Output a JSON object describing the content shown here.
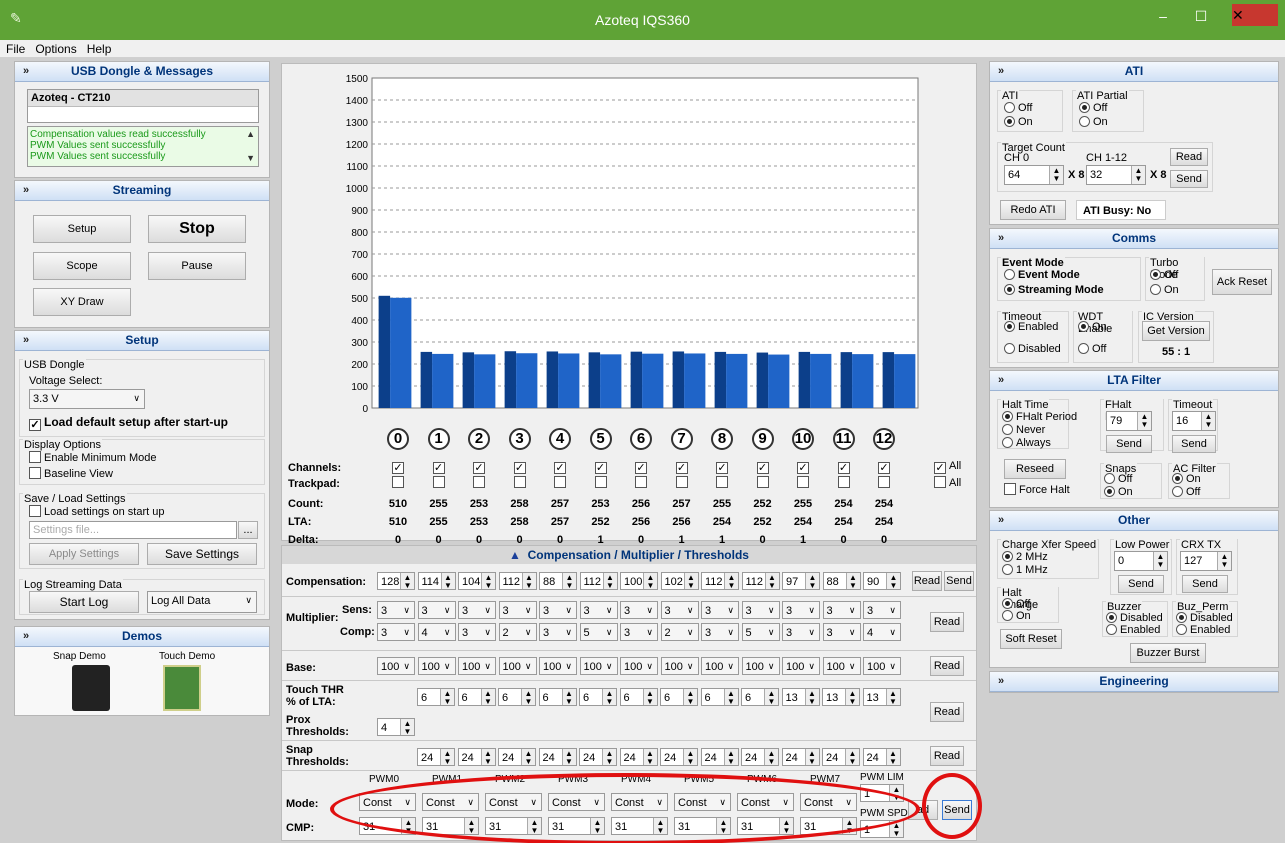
{
  "window": {
    "title": "Azoteq IQS360"
  },
  "menu": [
    "File",
    "Options",
    "Help"
  ],
  "left": {
    "usb": {
      "title": "USB Dongle & Messages",
      "device": "Azoteq - CT210",
      "messages": [
        "Compensation values read successfully",
        "PWM Values sent successfully",
        "PWM Values sent successfully"
      ]
    },
    "streaming": {
      "title": "Streaming",
      "setup": "Setup",
      "stop": "Stop",
      "scope": "Scope",
      "pause": "Pause",
      "xy": "XY Draw"
    },
    "setup": {
      "title": "Setup",
      "usb_group": "USB Dongle",
      "voltage_label": "Voltage Select:",
      "voltage": "3.3 V",
      "load_default": "Load default setup after start-up",
      "display_group": "Display Options",
      "min_mode": "Enable Minimum Mode",
      "baseline": "Baseline View",
      "save_group": "Save / Load Settings",
      "load_on_start": "Load settings on start up",
      "settings_placeholder": "Settings file...",
      "browse": "...",
      "apply": "Apply Settings",
      "save": "Save Settings",
      "log_group": "Log Streaming Data",
      "start_log": "Start Log",
      "log_mode": "Log All Data"
    },
    "demos": {
      "title": "Demos",
      "snap": "Snap Demo",
      "touch": "Touch Demo"
    }
  },
  "chart_data": {
    "type": "bar",
    "categories": [
      "0",
      "1",
      "2",
      "3",
      "4",
      "5",
      "6",
      "7",
      "8",
      "9",
      "10",
      "11",
      "12"
    ],
    "values": [
      510,
      255,
      253,
      258,
      257,
      253,
      256,
      257,
      255,
      252,
      255,
      254,
      254
    ],
    "ylim": [
      0,
      1500
    ],
    "yticks": [
      "0",
      "100",
      "200",
      "300",
      "400",
      "500",
      "600",
      "700",
      "800",
      "900",
      "1000",
      "1100",
      "1200",
      "1300",
      "1400",
      "1500"
    ],
    "grid": true,
    "colors": {
      "front": "#1f64c8",
      "back": "#0c3f8a"
    }
  },
  "table": {
    "labels": {
      "channels": "Channels:",
      "trackpad": "Trackpad:",
      "count": "Count:",
      "lta": "LTA:",
      "delta": "Delta:",
      "all": "All"
    },
    "channels": [
      "0",
      "1",
      "2",
      "3",
      "4",
      "5",
      "6",
      "7",
      "8",
      "9",
      "10",
      "11",
      "12"
    ],
    "count": [
      "510",
      "255",
      "253",
      "258",
      "257",
      "253",
      "256",
      "257",
      "255",
      "252",
      "255",
      "254",
      "254"
    ],
    "lta": [
      "510",
      "255",
      "253",
      "258",
      "257",
      "252",
      "256",
      "256",
      "254",
      "252",
      "254",
      "254",
      "254"
    ],
    "delta": [
      "0",
      "0",
      "0",
      "0",
      "0",
      "1",
      "0",
      "1",
      "1",
      "0",
      "1",
      "0",
      "0"
    ]
  },
  "comp": {
    "header": "Compensation / Multiplier / Thresholds",
    "compensation_label": "Compensation:",
    "compensation": [
      "128",
      "114",
      "104",
      "112",
      "88",
      "112",
      "100",
      "102",
      "112",
      "112",
      "97",
      "88",
      "90"
    ],
    "read": "Read",
    "send": "Send",
    "multiplier_label": "Multiplier:",
    "sens_label": "Sens:",
    "comp_label": "Comp:",
    "sens": [
      "3",
      "3",
      "3",
      "3",
      "3",
      "3",
      "3",
      "3",
      "3",
      "3",
      "3",
      "3",
      "3"
    ],
    "compm": [
      "3",
      "4",
      "3",
      "2",
      "3",
      "5",
      "3",
      "2",
      "3",
      "5",
      "3",
      "3",
      "4"
    ],
    "base_label": "Base:",
    "base": [
      "100",
      "100",
      "100",
      "100",
      "100",
      "100",
      "100",
      "100",
      "100",
      "100",
      "100",
      "100",
      "100"
    ],
    "touch_label": "Touch THR\n% of LTA:",
    "touch": [
      "6",
      "6",
      "6",
      "6",
      "6",
      "6",
      "6",
      "6",
      "6",
      "13",
      "13",
      "13"
    ],
    "prox_label": "Prox\nThresholds:",
    "prox": "4",
    "snap_label": "Snap\nThresholds:",
    "snap": [
      "24",
      "24",
      "24",
      "24",
      "24",
      "24",
      "24",
      "24",
      "24",
      "24",
      "24",
      "24"
    ]
  },
  "pwm": {
    "headers": [
      "PWM0",
      "PWM1",
      "PWM2",
      "PWM3",
      "PWM4",
      "PWM5",
      "PWM6",
      "PWM7"
    ],
    "mode_label": "Mode:",
    "cmp_label": "CMP:",
    "modes": [
      "Const",
      "Const",
      "Const",
      "Const",
      "Const",
      "Const",
      "Const",
      "Const"
    ],
    "cmp": [
      "31",
      "31",
      "31",
      "31",
      "31",
      "31",
      "31",
      "31"
    ],
    "lim_label": "PWM LIM",
    "lim": "1",
    "spd_label": "PWM SPD",
    "spd": "1",
    "read": "ad",
    "send": "Send"
  },
  "right": {
    "ati": {
      "title": "ATI",
      "ati_group": "ATI",
      "off": "Off",
      "on": "On",
      "partial_group": "ATI Partial",
      "target_group": "Target Count",
      "ch0": "CH 0",
      "ch112": "CH 1-12",
      "t0": "64",
      "t1": "32",
      "x8": "X 8",
      "read": "Read",
      "send": "Send",
      "redo": "Redo ATI",
      "busy": "ATI Busy:  No"
    },
    "comms": {
      "title": "Comms",
      "event_group": "Event Mode",
      "event": "Event Mode",
      "streaming": "Streaming Mode",
      "turbo_group": "Turbo Mode",
      "off": "Off",
      "on": "On",
      "ack": "Ack Reset",
      "timeout_group": "Timeout",
      "enabled": "Enabled",
      "disabled": "Disabled",
      "wdt_group": "WDT Enable",
      "ic_group": "IC Version",
      "get_version": "Get Version",
      "version": "55 : 1"
    },
    "lta": {
      "title": "LTA Filter",
      "halt_group": "Halt Time",
      "fhalt": "FHalt Period",
      "never": "Never",
      "always": "Always",
      "fhalt_group": "FHalt Period",
      "fhalt_val": "79",
      "timeout_group": "Timeout",
      "timeout_val": "16",
      "send": "Send",
      "reseed": "Reseed",
      "force_halt": "Force Halt",
      "snaps_group": "Snaps",
      "ac_group": "AC Filter",
      "off": "Off",
      "on": "On"
    },
    "other": {
      "title": "Other",
      "xfer_group": "Charge Xfer Speed",
      "mhz2": "2 MHz",
      "mhz1": "1 MHz",
      "lp_group": "Low Power",
      "lp_val": "0",
      "crx_group": "CRX TX Vss",
      "crx_val": "127",
      "send": "Send",
      "halt_group": "Halt Charge",
      "off": "Off",
      "on": "On",
      "buzzer_group": "Buzzer",
      "buzperm_group": "Buz_Perm",
      "disabled": "Disabled",
      "enabled": "Enabled",
      "soft_reset": "Soft Reset",
      "buzzer_burst": "Buzzer Burst"
    },
    "engineering": {
      "title": "Engineering"
    }
  }
}
